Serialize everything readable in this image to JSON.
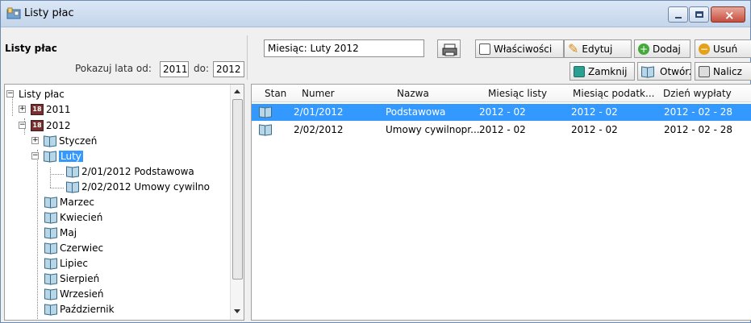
{
  "window": {
    "title": "Listy płac",
    "controls": {
      "minimize": "minimize",
      "maximize": "maximize",
      "close": "close"
    }
  },
  "sidebar": {
    "heading": "Listy płac",
    "years_from_label": "Pokazuj lata od:",
    "year_from": "2011",
    "years_to_label": "do:",
    "year_to": "2012"
  },
  "toolbar": {
    "month": "Miesiąc: Luty 2012",
    "properties": "Właściwości",
    "edit": "Edytuj",
    "add": "Dodaj",
    "delete": "Usuń",
    "close": "Zamknij",
    "open": "Otwórz",
    "calculate": "Nalicz"
  },
  "tree": {
    "root": "Listy płac",
    "year_2011": "2011",
    "year_2012": "2012",
    "styczen": "Styczeń",
    "luty": "Luty",
    "list_1": "2/01/2012  Podstawowa",
    "list_2": "2/02/2012  Umowy cywilno",
    "marzec": "Marzec",
    "kwiecien": "Kwiecień",
    "maj": "Maj",
    "czerwiec": "Czerwiec",
    "lipiec": "Lipiec",
    "sierpien": "Sierpień",
    "wrzesien": "Wrzesień",
    "pazdziernik": "Październik"
  },
  "table": {
    "headers": [
      "Stan",
      "Numer",
      "Nazwa",
      "Miesiąc listy",
      "Miesiąc podatk...",
      "Dzień wypłaty"
    ],
    "rows": [
      [
        "",
        "2/01/2012",
        "Podstawowa",
        "2012 - 02",
        "2012 - 02",
        "2012 - 02 - 28"
      ],
      [
        "",
        "2/02/2012",
        "Umowy cywilnopr...",
        "2012 - 02",
        "2012 - 02",
        "2012 - 02 - 28"
      ]
    ]
  },
  "colors": {
    "selection": "#3399ff",
    "accent": "#6d8bb0"
  }
}
